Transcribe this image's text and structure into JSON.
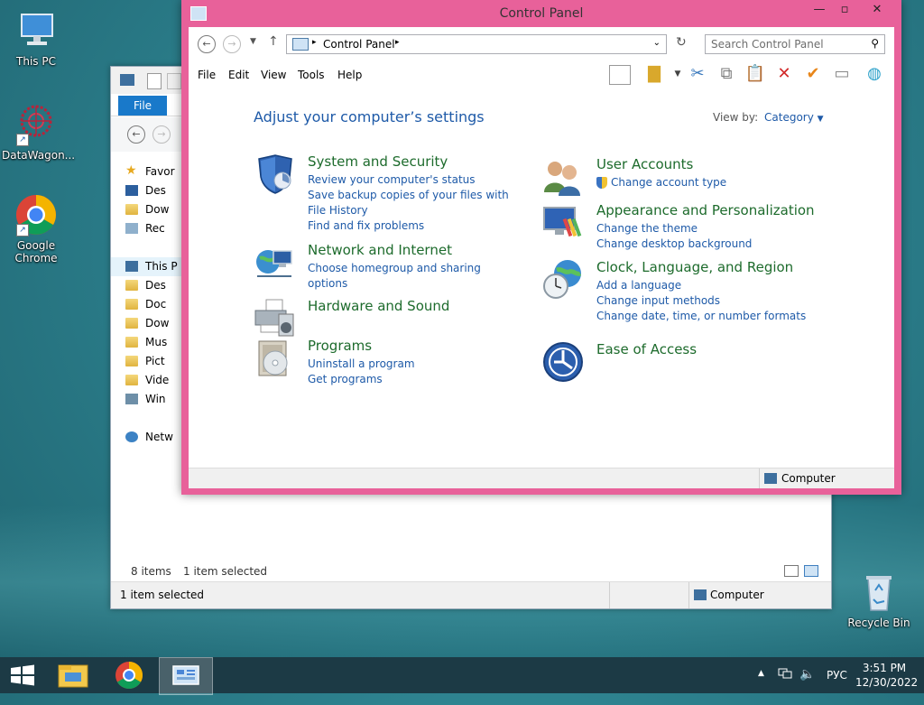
{
  "desktop": {
    "icons": [
      {
        "label": "This PC",
        "icon": "computer-icon"
      },
      {
        "label": "DataWagon...",
        "icon": "datawagon-icon"
      },
      {
        "label": "Google Chrome",
        "icon": "chrome-icon"
      },
      {
        "label": "Recycle Bin",
        "icon": "recycle-bin-icon"
      }
    ]
  },
  "explorer": {
    "file_tab": "File",
    "tree": [
      {
        "label": "Favor",
        "icon": "star-icon"
      },
      {
        "label": "Des",
        "icon": "desktop-folder-icon"
      },
      {
        "label": "Dow",
        "icon": "downloads-folder-icon"
      },
      {
        "label": "Rec",
        "icon": "recent-places-icon"
      },
      {
        "label": "This P",
        "icon": "computer-icon"
      },
      {
        "label": "Des",
        "icon": "folder-icon"
      },
      {
        "label": "Doc",
        "icon": "folder-icon"
      },
      {
        "label": "Dow",
        "icon": "folder-icon"
      },
      {
        "label": "Mus",
        "icon": "folder-icon"
      },
      {
        "label": "Pict",
        "icon": "folder-icon"
      },
      {
        "label": "Vide",
        "icon": "folder-icon"
      },
      {
        "label": "Win",
        "icon": "drive-icon"
      },
      {
        "label": "Netw",
        "icon": "network-icon"
      }
    ],
    "items_count": "8 items",
    "selection": "1 item selected",
    "status_left": "1 item selected",
    "status_right": "Computer"
  },
  "control_panel": {
    "title": "Control Panel",
    "address": "Control Panel",
    "search_placeholder": "Search Control Panel",
    "menu": [
      "File",
      "Edit",
      "View",
      "Tools",
      "Help"
    ],
    "heading": "Adjust your computer’s settings",
    "view_by_label": "View by:",
    "view_by_value": "Category",
    "categories": [
      {
        "title": "System and Security",
        "icon": "shield-icon",
        "links": [
          "Review your computer's status",
          "Save backup copies of your files with File History",
          "Find and fix problems"
        ]
      },
      {
        "title": "Network and Internet",
        "icon": "network-globe-icon",
        "links": [
          "Choose homegroup and sharing options"
        ]
      },
      {
        "title": "Hardware and Sound",
        "icon": "printer-speaker-icon",
        "links": []
      },
      {
        "title": "Programs",
        "icon": "programs-disc-icon",
        "links": [
          "Uninstall a program",
          "Get programs"
        ]
      },
      {
        "title": "User Accounts",
        "icon": "users-icon",
        "links": [
          "Change account type"
        ]
      },
      {
        "title": "Appearance and Personalization",
        "icon": "monitor-palette-icon",
        "links": [
          "Change the theme",
          "Change desktop background"
        ]
      },
      {
        "title": "Clock, Language, and Region",
        "icon": "clock-globe-icon",
        "links": [
          "Add a language",
          "Change input methods",
          "Change date, time, or number formats"
        ]
      },
      {
        "title": "Ease of Access",
        "icon": "ease-of-access-icon",
        "links": []
      }
    ],
    "status_right": "Computer"
  },
  "taskbar": {
    "language": "РУС",
    "time": "3:51 PM",
    "date": "12/30/2022"
  },
  "colors": {
    "cp_frame": "#e8619a",
    "link": "#1e5aa8",
    "category_title": "#1d6b2c",
    "taskbar": "#1c3a45"
  }
}
